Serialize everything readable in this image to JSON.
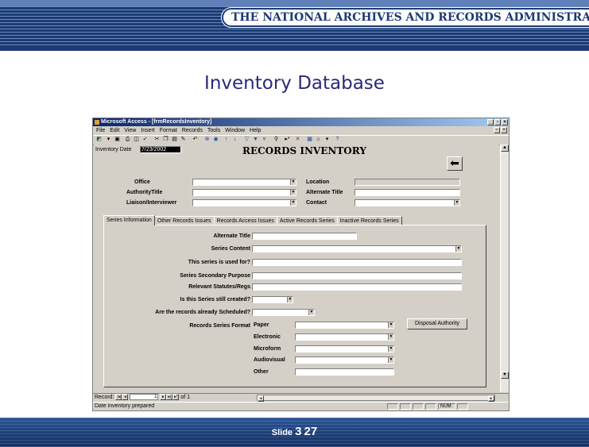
{
  "slide": {
    "agency": "THE NATIONAL ARCHIVES AND RECORDS ADMINISTRATION",
    "title": "Inventory Database",
    "slide_label": "Slide",
    "slide_number": "3",
    "slide_total": "27"
  },
  "window": {
    "title": "Microsoft Access - [frmRecordsInventory]",
    "menu": [
      "File",
      "Edit",
      "View",
      "Insert",
      "Format",
      "Records",
      "Tools",
      "Window",
      "Help"
    ]
  },
  "form": {
    "heading": "RECORDS INVENTORY",
    "inventory_date_label": "Inventory Date",
    "inventory_date_value": "7/23/2002",
    "office_label": "Office",
    "authority_title_label": "AuthorityTitle",
    "liaison_label": "Liaison/Interviewer",
    "location_label": "Location",
    "alternate_title_label": "Alternate Title",
    "contact_label": "Contact"
  },
  "tabs": [
    "Series Information",
    "Other Records Issues",
    "Records Access Issues",
    "Active Records Series",
    "Inactive Records Series"
  ],
  "series": {
    "alternate_title_label": "Alternate Title",
    "series_content_label": "Series Content",
    "used_for_label": "This series is used for?",
    "secondary_purpose_label": "Series Secondary Purpose",
    "statutes_label": "Relevant Statutes/Regs",
    "still_created_label": "Is this Series still created?",
    "already_scheduled_label": "Are the records already Scheduled?",
    "format_label": "Records Series Format",
    "formats": [
      "Paper",
      "Electronic",
      "Microform",
      "Audiovisual",
      "Other"
    ],
    "disposal_button": "Disposal Authority"
  },
  "nav": {
    "record_label": "Record:",
    "record_number": "1",
    "of_text": "of 1"
  },
  "status": {
    "text": "Date inventory prepared",
    "num": "NUM"
  }
}
